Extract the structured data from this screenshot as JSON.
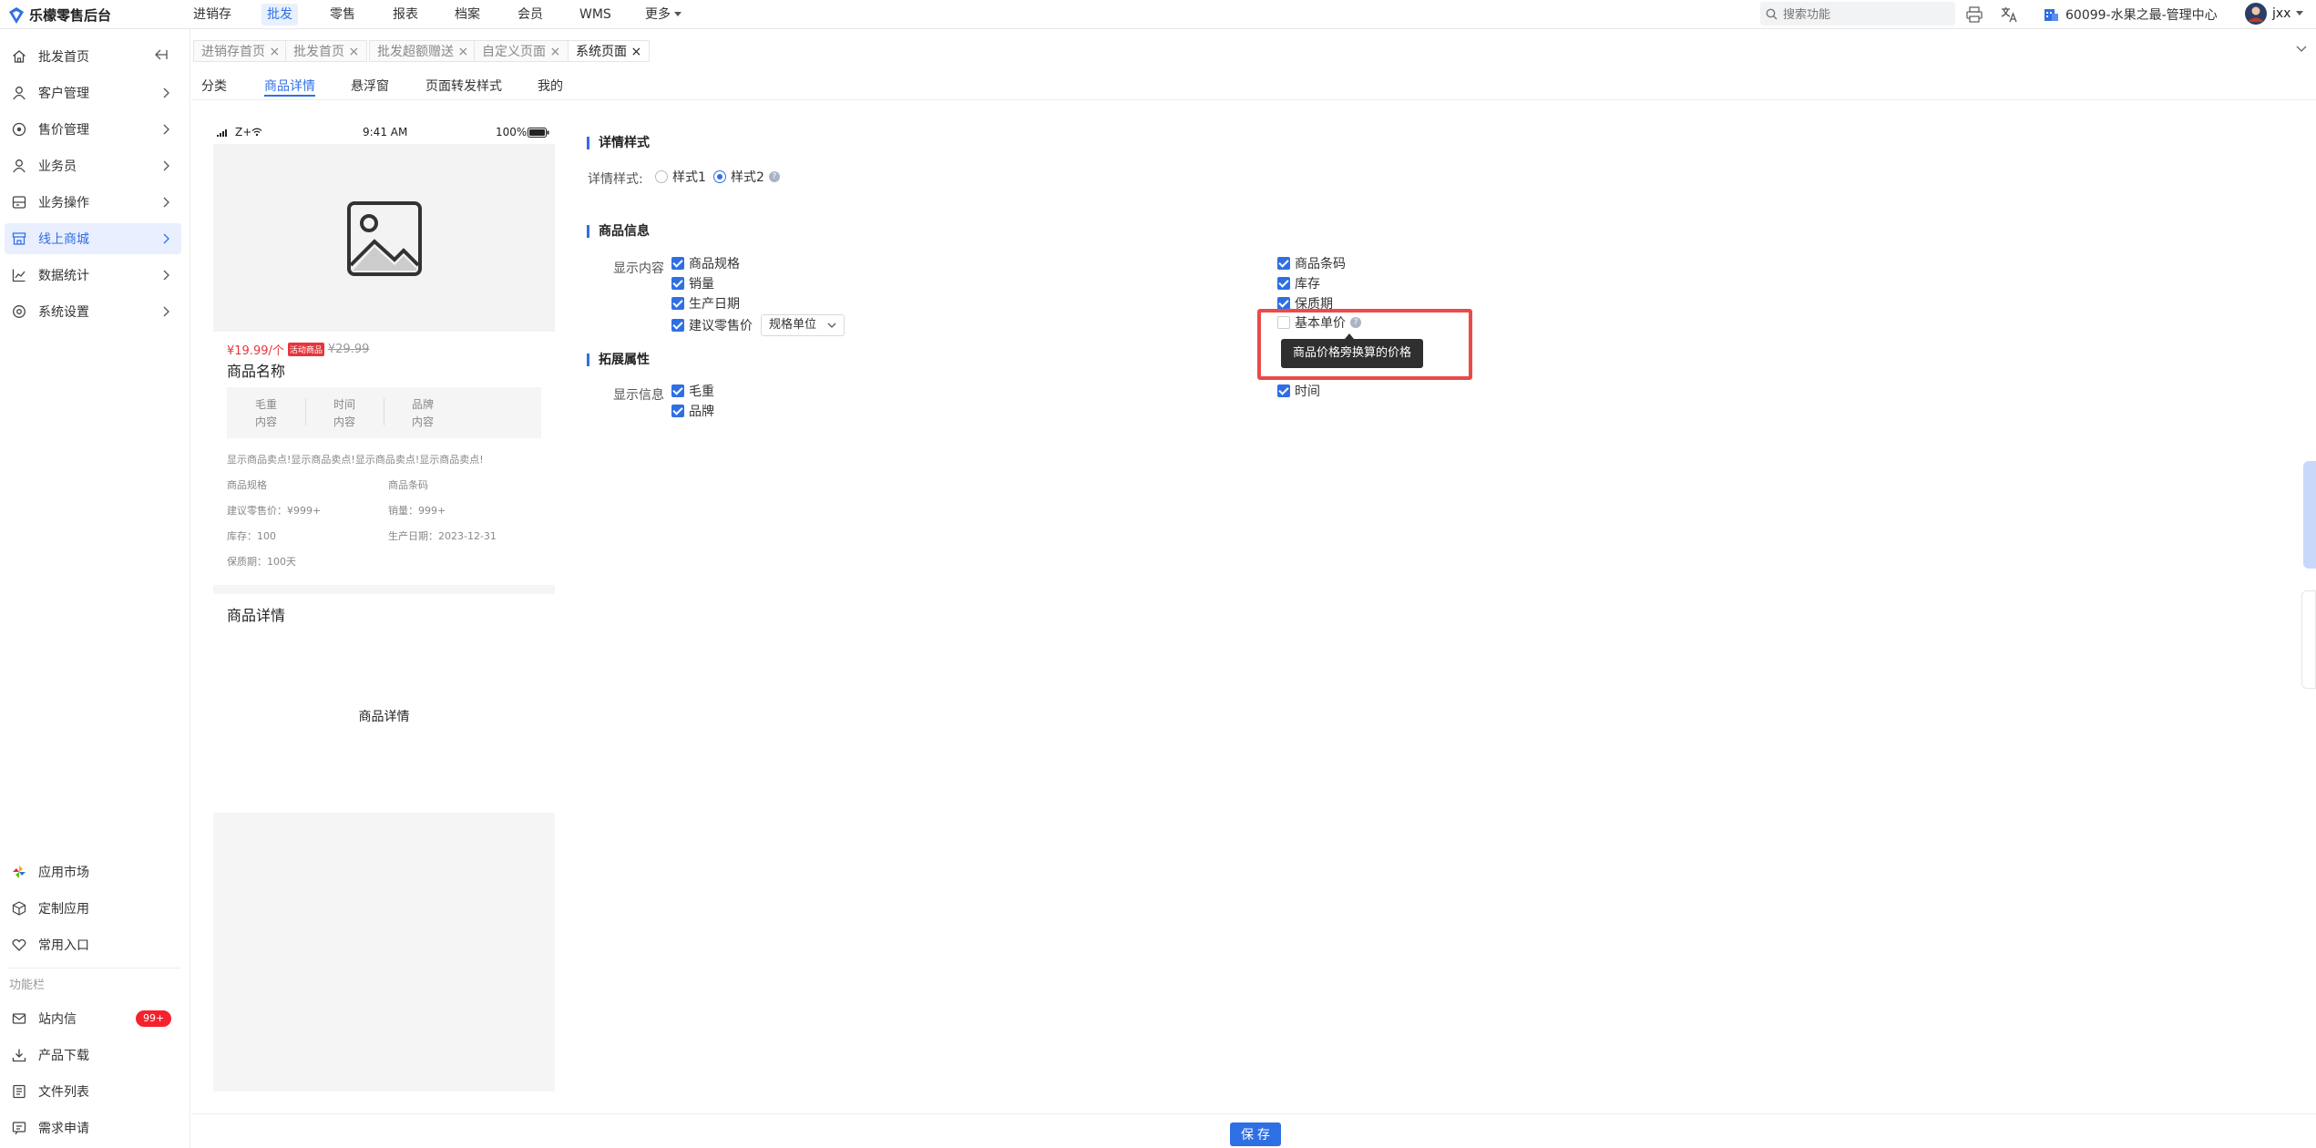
{
  "app": {
    "title": "乐檬零售后台"
  },
  "topnav": [
    "进销存",
    "批发",
    "零售",
    "报表",
    "档案",
    "会员",
    "WMS",
    "更多"
  ],
  "topnav_active": 1,
  "search": {
    "placeholder": "搜索功能"
  },
  "store": "60099-水果之最-管理中心",
  "user": "jxx",
  "sidebar": {
    "items": [
      "批发首页",
      "客户管理",
      "售价管理",
      "业务员",
      "业务操作",
      "线上商城",
      "数据统计",
      "系统设置"
    ],
    "active": 5,
    "bottom_items": [
      "应用市场",
      "定制应用",
      "常用入口"
    ],
    "section_label": "功能栏",
    "func_items": [
      "站内信",
      "产品下载",
      "文件列表",
      "需求申请"
    ],
    "badge": "99+"
  },
  "page_tabs": [
    "进销存首页",
    "批发首页",
    "批发超额赠送",
    "自定义页面",
    "系统页面"
  ],
  "sub_tabs": [
    "分类",
    "商品详情",
    "悬浮窗",
    "页面转发样式",
    "我的"
  ],
  "phone": {
    "status_left": "Z+",
    "time": "9:41 AM",
    "battery": "100%",
    "price": "¥19.99/个",
    "promo_tag": "活动商品",
    "orig_price": "¥29.99",
    "product_name": "商品名称",
    "attrs": [
      {
        "k": "毛重",
        "v": "内容"
      },
      {
        "k": "时间",
        "v": "内容"
      },
      {
        "k": "品牌",
        "v": "内容"
      }
    ],
    "selling_point": "显示商品卖点!显示商品卖点!显示商品卖点!显示商品卖点!",
    "spec_label": "商品规格",
    "barcode_label": "商品条码",
    "retail_price": "建议零售价：¥999+",
    "sales": "销量：999+",
    "stock": "库存：100",
    "prod_date": "生产日期：2023-12-31",
    "shelf_life": "保质期：100天",
    "detail_title": "商品详情",
    "detail_placeholder": "商品详情"
  },
  "config": {
    "style_title": "详情样式",
    "style_label": "详情样式:",
    "style1": "样式1",
    "style2": "样式2",
    "info_title": "商品信息",
    "display_label": "显示内容",
    "left_fields": [
      "商品规格",
      "销量",
      "生产日期",
      "建议零售价"
    ],
    "right_fields": [
      "商品条码",
      "库存",
      "保质期",
      "基本单价"
    ],
    "unit_select": "规格单位",
    "tooltip": "商品价格旁换算的价格",
    "ext_title": "拓展属性",
    "ext_label": "显示信息",
    "ext_left": [
      "毛重",
      "品牌"
    ],
    "ext_right": [
      "时间"
    ]
  },
  "save_label": "保 存",
  "colors": {
    "accent": "#2f6fe4",
    "highlight": "#e94a4a",
    "badge": "#f5222d"
  }
}
